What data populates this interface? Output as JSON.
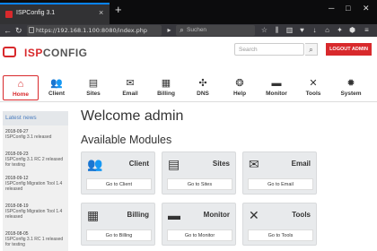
{
  "browser": {
    "tab_title": "ISPConfig 3.1",
    "new_tab": "+",
    "url": "https://192.168.1.100:8080/index.php",
    "search_placeholder": "Suchen",
    "tab_close": "×",
    "win_min": "─",
    "win_max": "□",
    "win_close": "✕"
  },
  "header": {
    "logo_isp": "ISP",
    "logo_config": "CONFIG",
    "search_placeholder": "Search",
    "logout_label": "LOGOUT ADMIN"
  },
  "modules_nav": [
    {
      "label": "Home",
      "icon": "home-icon",
      "glyph": "⌂",
      "active": true
    },
    {
      "label": "Client",
      "icon": "client-icon",
      "glyph": "👥",
      "active": false
    },
    {
      "label": "Sites",
      "icon": "sites-icon",
      "glyph": "▤",
      "active": false
    },
    {
      "label": "Email",
      "icon": "email-icon",
      "glyph": "✉",
      "active": false
    },
    {
      "label": "Billing",
      "icon": "billing-icon",
      "glyph": "▦",
      "active": false
    },
    {
      "label": "DNS",
      "icon": "dns-icon",
      "glyph": "✣",
      "active": false
    },
    {
      "label": "Help",
      "icon": "help-icon",
      "glyph": "❂",
      "active": false
    },
    {
      "label": "Monitor",
      "icon": "monitor-icon",
      "glyph": "▬",
      "active": false
    },
    {
      "label": "Tools",
      "icon": "tools-icon",
      "glyph": "✕",
      "active": false
    },
    {
      "label": "System",
      "icon": "system-icon",
      "glyph": "✹",
      "active": false
    }
  ],
  "sidebar": {
    "title": "Latest news",
    "news": [
      {
        "date": "2018-09-27",
        "text": "ISPConfig 3.1 released"
      },
      {
        "date": "2018-09-23",
        "text": "ISPConfig 3.1 RC 2 released for testing"
      },
      {
        "date": "2018-09-12",
        "text": "ISPConfig Migration Tool 1.4 released"
      },
      {
        "date": "2018-08-19",
        "text": "ISPConfig Migration Tool 1.4 released"
      },
      {
        "date": "2018-08-05",
        "text": "ISPConfig 3.1 RC 1 released for testing"
      }
    ]
  },
  "main": {
    "welcome": "Welcome admin",
    "available_modules": "Available Modules",
    "cards": [
      {
        "title": "Client",
        "button": "Go to Client",
        "icon": "client-icon",
        "glyph": "👥"
      },
      {
        "title": "Sites",
        "button": "Go to Sites",
        "icon": "sites-icon",
        "glyph": "▤"
      },
      {
        "title": "Email",
        "button": "Go to Email",
        "icon": "email-icon",
        "glyph": "✉"
      },
      {
        "title": "Billing",
        "button": "Go to Billing",
        "icon": "billing-icon",
        "glyph": "▦"
      },
      {
        "title": "Monitor",
        "button": "Go to Monitor",
        "icon": "monitor-icon",
        "glyph": "▬"
      },
      {
        "title": "Tools",
        "button": "Go to Tools",
        "icon": "tools-icon",
        "glyph": "✕"
      }
    ]
  },
  "colors": {
    "brand": "#d8292c",
    "link": "#4b7dbf"
  }
}
